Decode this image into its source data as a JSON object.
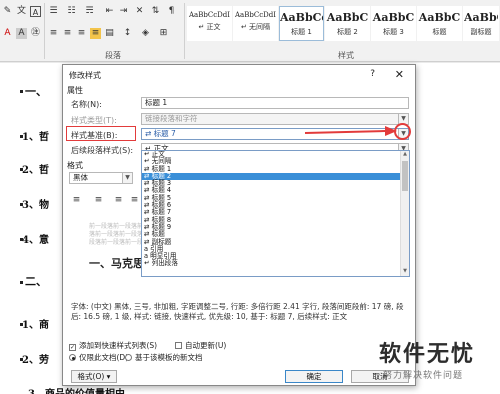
{
  "ribbon": {
    "style_gallery": [
      {
        "sample": "AaBbCcDdI",
        "name": "↵ 正文",
        "big": false
      },
      {
        "sample": "AaBbCcDdI",
        "name": "↵ 无间隔",
        "big": false
      },
      {
        "sample": "AaBbCc",
        "name": "标题 1",
        "big": true
      },
      {
        "sample": "AaBbC",
        "name": "标题 2",
        "big": true
      },
      {
        "sample": "AaBbC",
        "name": "标题 3",
        "big": true
      },
      {
        "sample": "AaBbC",
        "name": "标题",
        "big": true
      },
      {
        "sample": "AaBbC",
        "name": "副标题",
        "big": true
      }
    ],
    "paragraph_label": "段落",
    "styles_label": "样式"
  },
  "document": {
    "lines": [
      "一、",
      "1、哲",
      "2、哲",
      "3、物",
      "4、意",
      "二、",
      "1、商",
      "2、劳",
      "3、商品的价值量相由"
    ]
  },
  "dialog": {
    "title": "修改样式",
    "help": "?",
    "close": "✕",
    "properties_label": "属性",
    "name_label": "名称(N):",
    "name_value": "标题 1",
    "type_label": "样式类型(T):",
    "type_value": "链接段落和字符",
    "based_label": "样式基准(B):",
    "based_value": "⇄ 标题 7",
    "next_label": "后续段落样式(S):",
    "next_value": "↵ 正文",
    "format_label": "格式",
    "font_value": "黑体",
    "preview_lines": [
      "前一段落前一段落前一段落前一段落前一段落前一段落",
      "落前一段落前一段落前一段落前一段落前一段落前一",
      "段落前一段落前一段落前一段落"
    ],
    "preview_heading": "一、马克思",
    "description": "字体: (中文) 黑体, 三号, 非加粗, 字距调整二号, 行距: 多倍行距 2.41 字行, 段落间距段前: 17 磅, 段后: 16.5 磅, 1 级, 样式: 链接, 快速样式, 优先级: 10, 基于: 标题 7, 后续样式: 正文",
    "add_to_gallery": "添加到快速样式列表(S)",
    "auto_update": "自动更新(U)",
    "only_this_doc": "仅限此文档(D)",
    "new_docs": "基于该模板的新文档",
    "format_button": "格式(O) ▾",
    "ok_button": "确定",
    "cancel_button": "取消",
    "style_list": [
      "↵ 正文",
      "↵ 无间隔",
      "⇄ 标题 1",
      "⇄ 标题 2",
      "⇄ 标题 3",
      "⇄ 标题 4",
      "⇄ 标题 5",
      "⇄ 标题 6",
      "⇄ 标题 7",
      "⇄ 标题 8",
      "⇄ 标题 9",
      "⇄ 标题",
      "⇄ 副标题",
      "a 引用",
      "a 明显引用",
      "↵ 列出段落"
    ],
    "selected_index": 3
  },
  "watermark": {
    "big": "软件无忧",
    "small": "努力解决软件问题"
  },
  "colors": {
    "accent": "#3a8fd8",
    "highlight": "#e23b3b"
  }
}
